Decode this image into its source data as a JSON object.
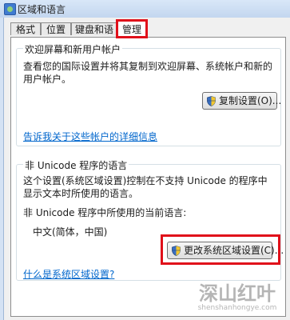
{
  "window": {
    "title": "区域和语言"
  },
  "tabs": [
    {
      "label": "格式"
    },
    {
      "label": "位置"
    },
    {
      "label": "键盘和语言"
    },
    {
      "label": "管理"
    }
  ],
  "welcome_group": {
    "title": "欢迎屏幕和新用户帐户",
    "description": "查看您的国际设置并将其复制到欢迎屏幕、系统帐户和新的用户帐户。",
    "copy_button": "复制设置(O)...",
    "link": "告诉我关于这些帐户的详细信息"
  },
  "unicode_group": {
    "title": "非 Unicode 程序的语言",
    "description": "这个设置(系统区域设置)控制在不支持 Unicode 的程序中显示文本时所使用的语言。",
    "current_label": "非 Unicode 程序中所使用的当前语言:",
    "current_value": "中文(简体，中国)",
    "change_button": "更改系统区域设置(C)...",
    "link": "什么是系统区域设置?"
  },
  "watermark": {
    "main": "深山红叶",
    "sub": "shenshanhongye.com"
  },
  "colors": {
    "highlight": "#e0101a",
    "link": "#0066cc",
    "titlebar": "#c3d6ef"
  }
}
